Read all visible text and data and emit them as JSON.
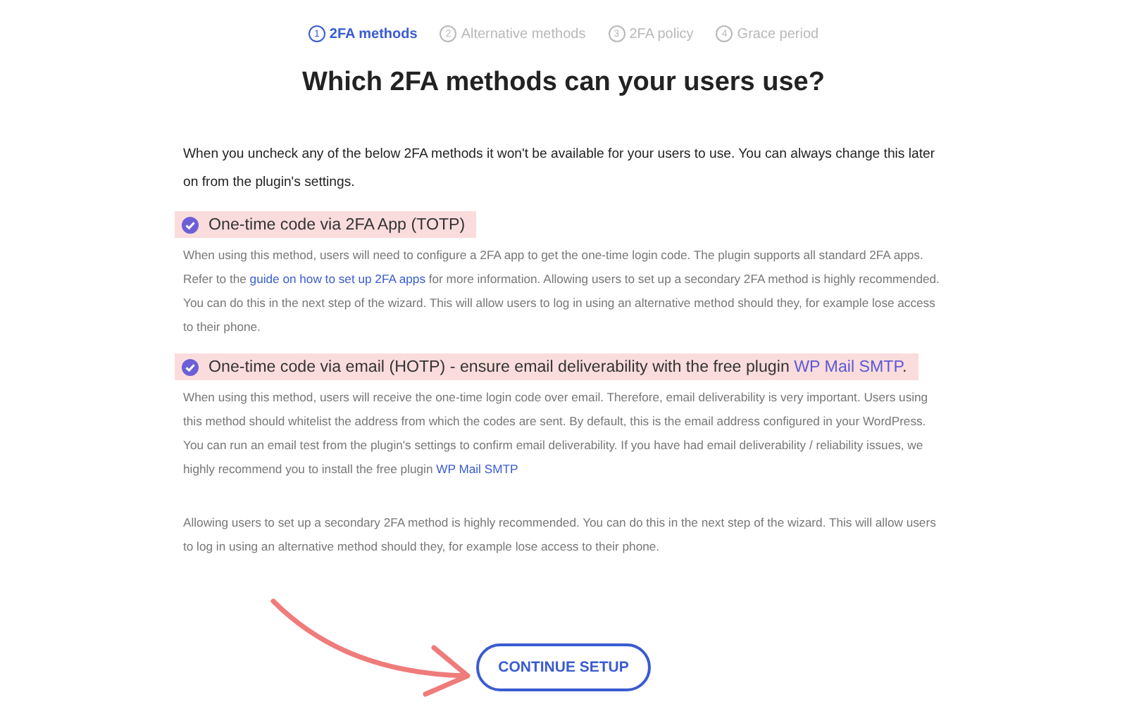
{
  "steps": [
    {
      "number": "1",
      "label": "2FA methods",
      "selected": true
    },
    {
      "number": "2",
      "label": "Alternative methods",
      "selected": false
    },
    {
      "number": "3",
      "label": "2FA policy",
      "selected": false
    },
    {
      "number": "4",
      "label": "Grace period",
      "selected": false
    }
  ],
  "heading": "Which 2FA methods can your users use?",
  "intro": "When you uncheck any of the below 2FA methods it won't be available for your users to use. You can always change this later on from the plugin's settings.",
  "methods": [
    {
      "checked": true,
      "highlighted": true,
      "title": [
        {
          "kind": "text",
          "text": "One-time code via 2FA App (TOTP)"
        }
      ],
      "description": [
        {
          "kind": "text",
          "text": "When using this method, users will need to configure a 2FA app to get the one-time login code. The plugin supports all standard 2FA apps. Refer to the "
        },
        {
          "kind": "link",
          "text": "guide on how to set up 2FA apps"
        },
        {
          "kind": "text",
          "text": " for more information. Allowing users to set up a secondary 2FA method is highly recommended. You can do this in the next step of the wizard. This will allow users to log in using an alternative method should they, for example lose access to their phone."
        }
      ]
    },
    {
      "checked": true,
      "highlighted": true,
      "title": [
        {
          "kind": "text",
          "text": "One-time code via email (HOTP) - ensure email deliverability with the free plugin "
        },
        {
          "kind": "link",
          "text": "WP Mail SMTP"
        },
        {
          "kind": "text",
          "text": "."
        }
      ],
      "description": [
        {
          "kind": "text",
          "text": "When using this method, users will receive the one-time login code over email. Therefore, email deliverability is very important. Users using this method should whitelist the address from which the codes are sent. By default, this is the email address configured in your WordPress. You can run an email test from the plugin's settings to confirm email deliverability. If you have had email deliverability / reliability issues, we highly recommend you to install the free plugin "
        },
        {
          "kind": "link",
          "text": "WP Mail SMTP"
        }
      ]
    }
  ],
  "note": "Allowing users to set up a secondary 2FA method is highly recommended. You can do this in the next step of the wizard. This will allow users to log in using an alternative method should they, for example lose access to their phone.",
  "button": "CONTINUE SETUP"
}
